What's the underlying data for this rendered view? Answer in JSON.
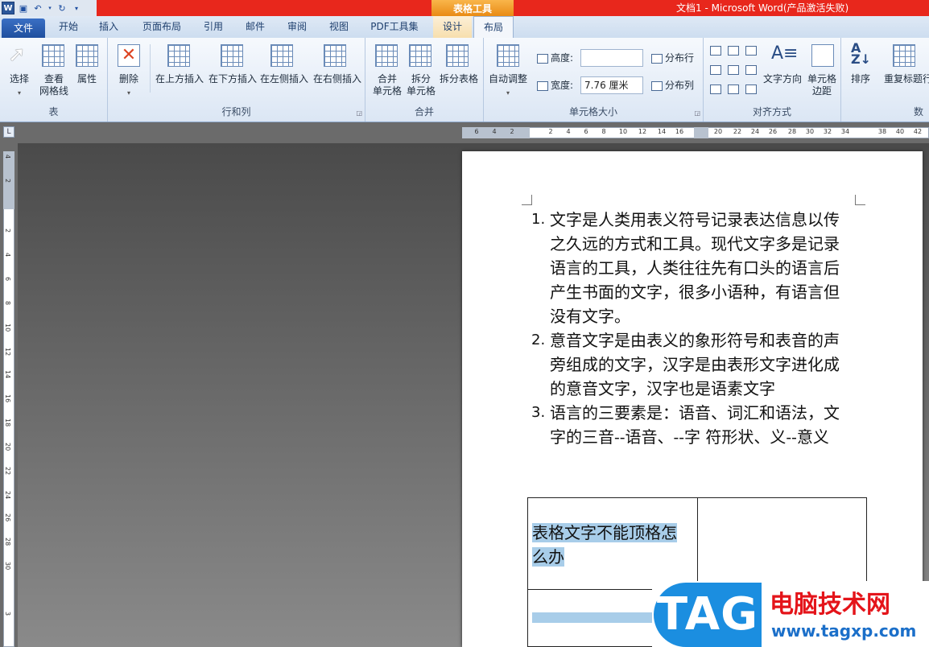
{
  "titlebar": {
    "word_icon": "W",
    "context_label": "表格工具",
    "window_title": "文档1 - Microsoft Word(产品激活失败)"
  },
  "tabs": [
    "文件",
    "开始",
    "插入",
    "页面布局",
    "引用",
    "邮件",
    "审阅",
    "视图",
    "PDF工具集",
    "设计",
    "布局"
  ],
  "ribbon": {
    "table_group": {
      "label": "表",
      "select": "选择",
      "gridlines": "查看\n网格线",
      "properties": "属性"
    },
    "rowcol_group": {
      "label": "行和列",
      "delete": "删除",
      "insert_above": "在上方插入",
      "insert_below": "在下方插入",
      "insert_left": "在左侧插入",
      "insert_right": "在右侧插入"
    },
    "merge_group": {
      "label": "合并",
      "merge_cells": "合并\n单元格",
      "split_cells": "拆分\n单元格",
      "split_table": "拆分表格"
    },
    "cellsize_group": {
      "label": "单元格大小",
      "autofit": "自动调整",
      "height_label": "高度:",
      "height_value": "",
      "width_label": "宽度:",
      "width_value": "7.76 厘米",
      "distribute_rows": "分布行",
      "distribute_cols": "分布列"
    },
    "align_group": {
      "label": "对齐方式",
      "text_direction": "文字方向",
      "cell_margins": "单元格\n边距"
    },
    "data_group": {
      "sort": "排序",
      "repeat_header": "重复标题行",
      "label": "数"
    }
  },
  "hruler_ticks": [
    "6",
    "4",
    "2",
    "2",
    "4",
    "6",
    "8",
    "10",
    "12",
    "14",
    "16",
    "20",
    "22",
    "24",
    "26",
    "28",
    "30",
    "32",
    "34",
    "38",
    "40",
    "42"
  ],
  "vruler_ticks": [
    "4",
    "2",
    "2",
    "4",
    "6",
    "8",
    "10",
    "12",
    "14",
    "16",
    "18",
    "20",
    "22",
    "24",
    "26",
    "28",
    "30",
    "3"
  ],
  "document": {
    "items": [
      {
        "num": "1.",
        "text": "文字是人类用表义符号记录表达信息以传之久远的方式和工具。现代文字多是记录语言的工具，人类往往先有口头的语言后产生书面的文字，很多小语种，有语言但没有文字。"
      },
      {
        "num": "2.",
        "text": "意音文字是由表义的象形符号和表音的声旁组成的文字，汉字是由表形文字进化成的意音文字，汉字也是语素文字"
      },
      {
        "num": "3.",
        "text": "语言的三要素是：语音、词汇和语法，文字的三音--语音、--字  符形状、义--意义"
      }
    ],
    "table_cell_text": " 表格文字不能顶格怎么办"
  },
  "watermark": {
    "tag": "TAG",
    "site_name": "电脑技术网",
    "url": "www.tagxp.com"
  }
}
